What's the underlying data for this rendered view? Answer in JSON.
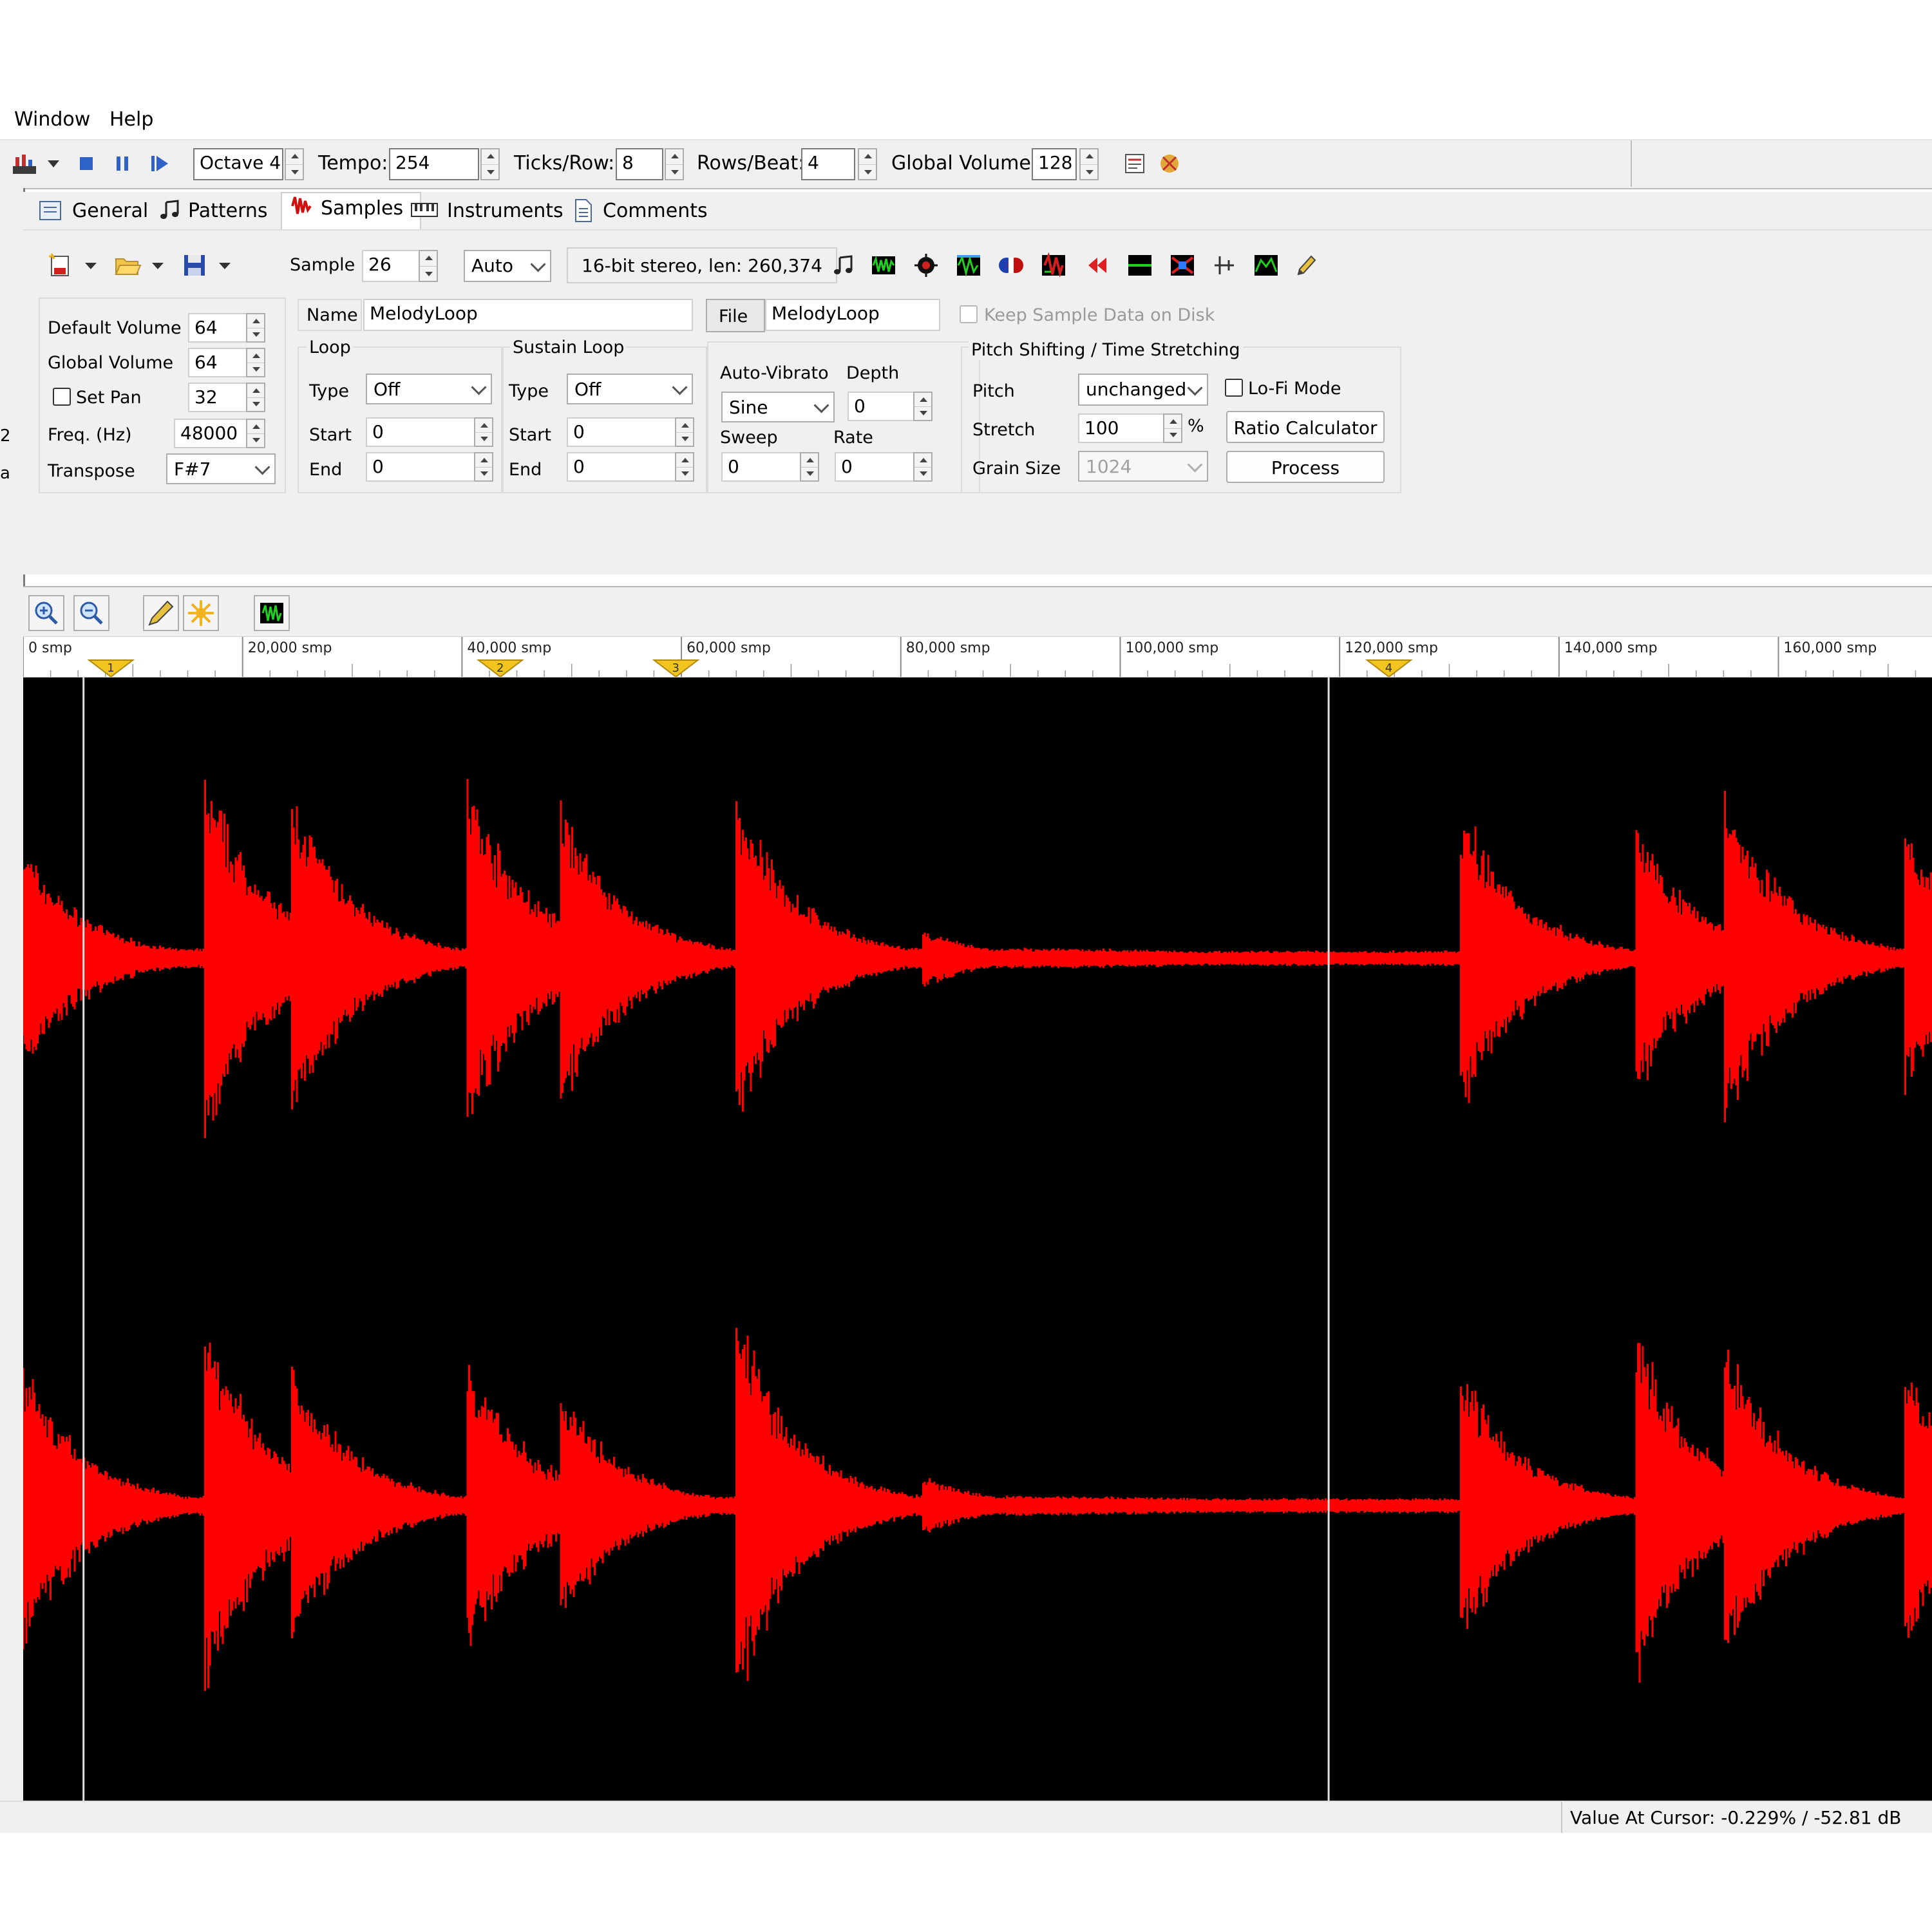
{
  "menu": {
    "items": [
      "Window",
      "Help"
    ]
  },
  "toolbar": {
    "octave": "Octave 4",
    "tempo_label": "Tempo:",
    "tempo_value": "254",
    "ticks_label": "Ticks/Row:",
    "ticks_value": "8",
    "rows_label": "Rows/Beat:",
    "rows_value": "4",
    "global_volume_label": "Global Volume:",
    "global_volume_value": "128",
    "vu_level": 0.16
  },
  "tabs": [
    {
      "label": "General",
      "icon": "general-icon"
    },
    {
      "label": "Patterns",
      "icon": "note-icon"
    },
    {
      "label": "Samples",
      "icon": "samples-icon"
    },
    {
      "label": "Instruments",
      "icon": "keyboard-icon"
    },
    {
      "label": "Comments",
      "icon": "document-icon"
    }
  ],
  "sample_toolbar": {
    "sample_label": "Sample",
    "sample_value": "26",
    "mode_value": "Auto",
    "info": "16-bit stereo, len: 260,374"
  },
  "props": {
    "default_volume_label": "Default Volume",
    "default_volume_value": "64",
    "global_volume_label": "Global Volume",
    "global_volume_value": "64",
    "set_pan_label": "Set Pan",
    "set_pan_value": "32",
    "freq_label": "Freq. (Hz)",
    "freq_value": "48000",
    "transpose_label": "Transpose",
    "transpose_value": "F#7"
  },
  "name": {
    "label": "Name",
    "value": "MelodyLoop"
  },
  "file": {
    "label": "File",
    "value": "MelodyLoop"
  },
  "keep_on_disk_label": "Keep Sample Data on Disk",
  "loop": {
    "title": "Loop",
    "type_label": "Type",
    "type_value": "Off",
    "start_label": "Start",
    "start_value": "0",
    "end_label": "End",
    "end_value": "0"
  },
  "sustain_loop": {
    "title": "Sustain Loop",
    "type_label": "Type",
    "type_value": "Off",
    "start_label": "Start",
    "start_value": "0",
    "end_label": "End",
    "end_value": "0"
  },
  "vibrato": {
    "title": "Auto-Vibrato",
    "type_value": "Sine",
    "depth_label": "Depth",
    "depth_value": "0",
    "sweep_label": "Sweep",
    "sweep_value": "0",
    "rate_label": "Rate",
    "rate_value": "0"
  },
  "pitch_shift": {
    "title": "Pitch Shifting / Time Stretching",
    "pitch_label": "Pitch",
    "pitch_value": "unchanged",
    "lofi_label": "Lo-Fi Mode",
    "stretch_label": "Stretch",
    "stretch_value": "100",
    "percent": "%",
    "ratio_button": "Ratio Calculator",
    "grain_label": "Grain Size",
    "grain_value": "1024",
    "process_button": "Process"
  },
  "ruler": {
    "ticks": [
      "0 smp",
      "20,000 smp",
      "40,000 smp",
      "60,000 smp",
      "80,000 smp",
      "100,000 smp",
      "120,000 smp",
      "140,000 smp",
      "160,000 smp"
    ],
    "cue_markers": [
      {
        "label": "1",
        "sample": 8000
      },
      {
        "label": "2",
        "sample": 43500
      },
      {
        "label": "3",
        "sample": 59500
      },
      {
        "label": "4",
        "sample": 124500
      }
    ]
  },
  "waveform": {
    "color": "#ff0000",
    "background": "#000000",
    "visible_range": [
      0,
      174000
    ],
    "selection_lines": [
      5500,
      119000
    ],
    "transients_ch1": [
      [
        0,
        0.46
      ],
      [
        16500,
        0.76
      ],
      [
        24500,
        0.68
      ],
      [
        40500,
        0.72
      ],
      [
        49000,
        0.64
      ],
      [
        65000,
        0.68
      ],
      [
        82000,
        0.12
      ],
      [
        131000,
        0.64
      ],
      [
        147000,
        0.56
      ],
      [
        155000,
        0.72
      ],
      [
        171500,
        0.56
      ]
    ],
    "transients_ch2": [
      [
        0,
        0.58
      ],
      [
        16500,
        0.76
      ],
      [
        24500,
        0.6
      ],
      [
        40500,
        0.6
      ],
      [
        49000,
        0.48
      ],
      [
        65000,
        0.8
      ],
      [
        82000,
        0.12
      ],
      [
        131000,
        0.58
      ],
      [
        147000,
        0.72
      ],
      [
        155000,
        0.68
      ],
      [
        171500,
        0.6
      ]
    ]
  },
  "status": {
    "text": "Value At Cursor: -0.229% / -52.81 dB"
  }
}
